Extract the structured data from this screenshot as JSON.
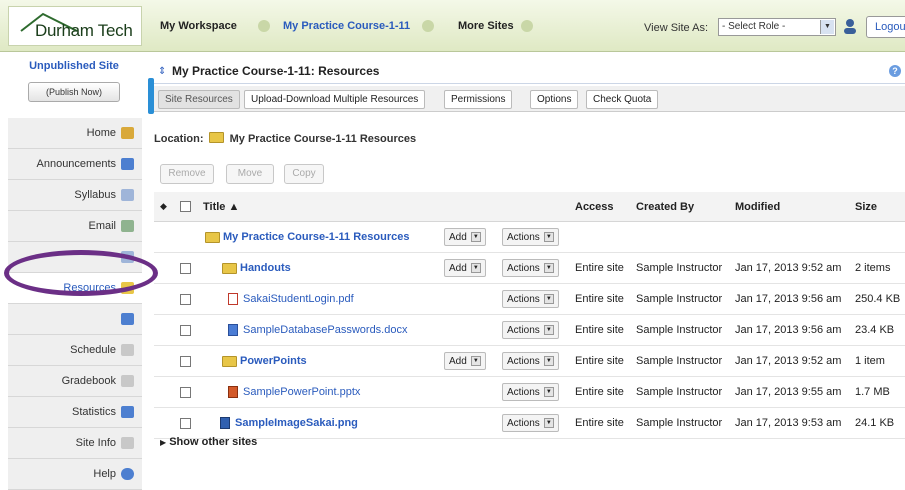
{
  "header": {
    "logo": "Durham Tech",
    "nav": [
      {
        "label": "My Workspace",
        "active": false
      },
      {
        "label": "My Practice Course-1-11",
        "active": true
      },
      {
        "label": "More Sites",
        "active": false
      }
    ],
    "view_site_as": "View Site As:",
    "role_select": "- Select Role -",
    "logout": "Logout"
  },
  "site": {
    "status": "Unpublished Site",
    "publish_button": "(Publish Now)"
  },
  "tools": [
    {
      "label": "Home",
      "icon": "home-icon",
      "color": "#d9a93a"
    },
    {
      "label": "Announcements",
      "icon": "announcements-icon",
      "color": "#4d7fd0"
    },
    {
      "label": "Syllabus",
      "icon": "syllabus-icon",
      "color": "#9fb5d9"
    },
    {
      "label": "Email",
      "icon": "email-icon",
      "color": "#8fb38f"
    },
    {
      "label": "",
      "icon": "",
      "color": ""
    },
    {
      "label": "Resources",
      "icon": "folder-icon",
      "color": "#e8c647",
      "selected": true
    },
    {
      "label": "",
      "icon": "",
      "color": ""
    },
    {
      "label": "Schedule",
      "icon": "schedule-icon",
      "color": "#c8c8c8"
    },
    {
      "label": "Gradebook",
      "icon": "gradebook-icon",
      "color": "#c8c8c8"
    },
    {
      "label": "Statistics",
      "icon": "statistics-icon",
      "color": "#4d7fd0"
    },
    {
      "label": "Site Info",
      "icon": "siteinfo-icon",
      "color": "#c8c8c8"
    },
    {
      "label": "Help",
      "icon": "help-icon",
      "color": "#4d7fd0"
    }
  ],
  "page": {
    "title": "My Practice Course-1-11: Resources",
    "tabs": [
      "Site Resources",
      "Upload-Download Multiple Resources",
      "Permissions",
      "Options",
      "Check Quota"
    ],
    "location_label": "Location:",
    "location_value": "My Practice Course-1-11 Resources",
    "buttons": [
      "Remove",
      "Move",
      "Copy"
    ]
  },
  "table": {
    "columns": [
      "Title ▲",
      "Access",
      "Created By",
      "Modified",
      "Size"
    ],
    "rows": [
      {
        "name": "My Practice Course-1-11 Resources",
        "type": "folder",
        "bold": true,
        "add": "Add",
        "actions": "Actions",
        "access": "",
        "created_by": "",
        "modified": "",
        "size": "",
        "checkbox": false,
        "indent": 0
      },
      {
        "name": "Handouts",
        "type": "folder",
        "bold": true,
        "add": "Add",
        "actions": "Actions",
        "access": "Entire site",
        "created_by": "Sample Instructor",
        "modified": "Jan 17, 2013 9:52 am",
        "size": "2 items",
        "checkbox": true,
        "indent": 1
      },
      {
        "name": "SakaiStudentLogin.pdf",
        "type": "pdf",
        "bold": false,
        "add": "",
        "actions": "Actions",
        "access": "Entire site",
        "created_by": "Sample Instructor",
        "modified": "Jan 17, 2013 9:56 am",
        "size": "250.4 KB",
        "checkbox": true,
        "indent": 2
      },
      {
        "name": "SampleDatabasePasswords.docx",
        "type": "doc",
        "bold": false,
        "add": "",
        "actions": "Actions",
        "access": "Entire site",
        "created_by": "Sample Instructor",
        "modified": "Jan 17, 2013 9:56 am",
        "size": "23.4 KB",
        "checkbox": true,
        "indent": 2
      },
      {
        "name": "PowerPoints",
        "type": "folder",
        "bold": true,
        "add": "Add",
        "actions": "Actions",
        "access": "Entire site",
        "created_by": "Sample Instructor",
        "modified": "Jan 17, 2013 9:52 am",
        "size": "1 item",
        "checkbox": true,
        "indent": 1
      },
      {
        "name": "SamplePowerPoint.pptx",
        "type": "ppt",
        "bold": false,
        "add": "",
        "actions": "Actions",
        "access": "Entire site",
        "created_by": "Sample Instructor",
        "modified": "Jan 17, 2013 9:55 am",
        "size": "1.7 MB",
        "checkbox": true,
        "indent": 2
      },
      {
        "name": "SampleImageSakai.png",
        "type": "png",
        "bold": true,
        "add": "",
        "actions": "Actions",
        "access": "Entire site",
        "created_by": "Sample Instructor",
        "modified": "Jan 17, 2013 9:53 am",
        "size": "24.1 KB",
        "checkbox": true,
        "indent": 1
      }
    ],
    "show_other": "Show other sites"
  }
}
